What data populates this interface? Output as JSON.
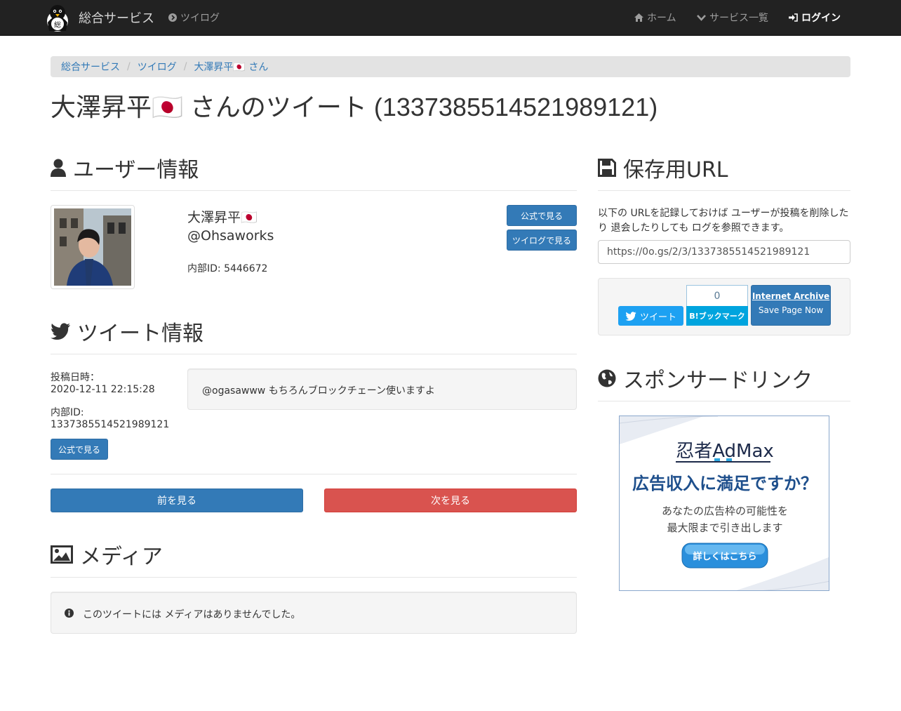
{
  "navbar": {
    "brand": "総合サービス",
    "brand_logo_text": "総",
    "twilog": "ツイログ",
    "home": "ホーム",
    "services": "サービス一覧",
    "login": "ログイン"
  },
  "breadcrumb": [
    "総合サービス",
    "ツイログ",
    "大澤昇平🇯🇵 さん"
  ],
  "page_title": "大澤昇平🇯🇵 さんのツイート (1337385514521989121)",
  "user_section": {
    "heading": "ユーザー情報",
    "name": "大澤昇平🇯🇵",
    "handle": "@Ohsaworks",
    "internal_id": "内部ID: 5446672",
    "btn_official": "公式で見る",
    "btn_twilog": "ツイログで見る"
  },
  "tweet_section": {
    "heading": "ツイート情報",
    "posted_label": "投稿日時：",
    "posted_value": "2020-12-11 22:15:28",
    "id_label": "内部ID:",
    "id_value": "1337385514521989121",
    "btn_official": "公式で見る",
    "text": "@ogasawww もちろんブロックチェーン使いますよ"
  },
  "nav_buttons": {
    "prev": "前を見る",
    "next": "次を見る"
  },
  "media_section": {
    "heading": "メディア",
    "empty_message": "このツイートには メディアはありませんでした。"
  },
  "save_url": {
    "heading": "保存用URL",
    "description_line1": "以下の URLを記録しておけば ユーザーが投稿を削除した",
    "description_line2": "り 退会したりしても ログを参照できます。",
    "url": "https://0o.gs/2/3/1337385514521989121",
    "tweet_button": "ツイート",
    "hatena_count": "0",
    "hatena_button": "B!ブックマーク",
    "archive_title": "Internet Archive",
    "archive_sub": "Save Page Now"
  },
  "sponsor": {
    "heading": "スポンサードリンク",
    "ad_brand": "忍者AdMax",
    "ad_headline": "広告収入に満足ですか？",
    "ad_body1": "あなたの広告枠の可能性を",
    "ad_body2": "最大限まで引き出します",
    "ad_button": "詳しくはこちら"
  },
  "colors": {
    "primary": "#337ab7",
    "danger": "#d9534f",
    "navbar": "#222222",
    "twitter": "#1da1f2",
    "hatena": "#00a4de"
  }
}
